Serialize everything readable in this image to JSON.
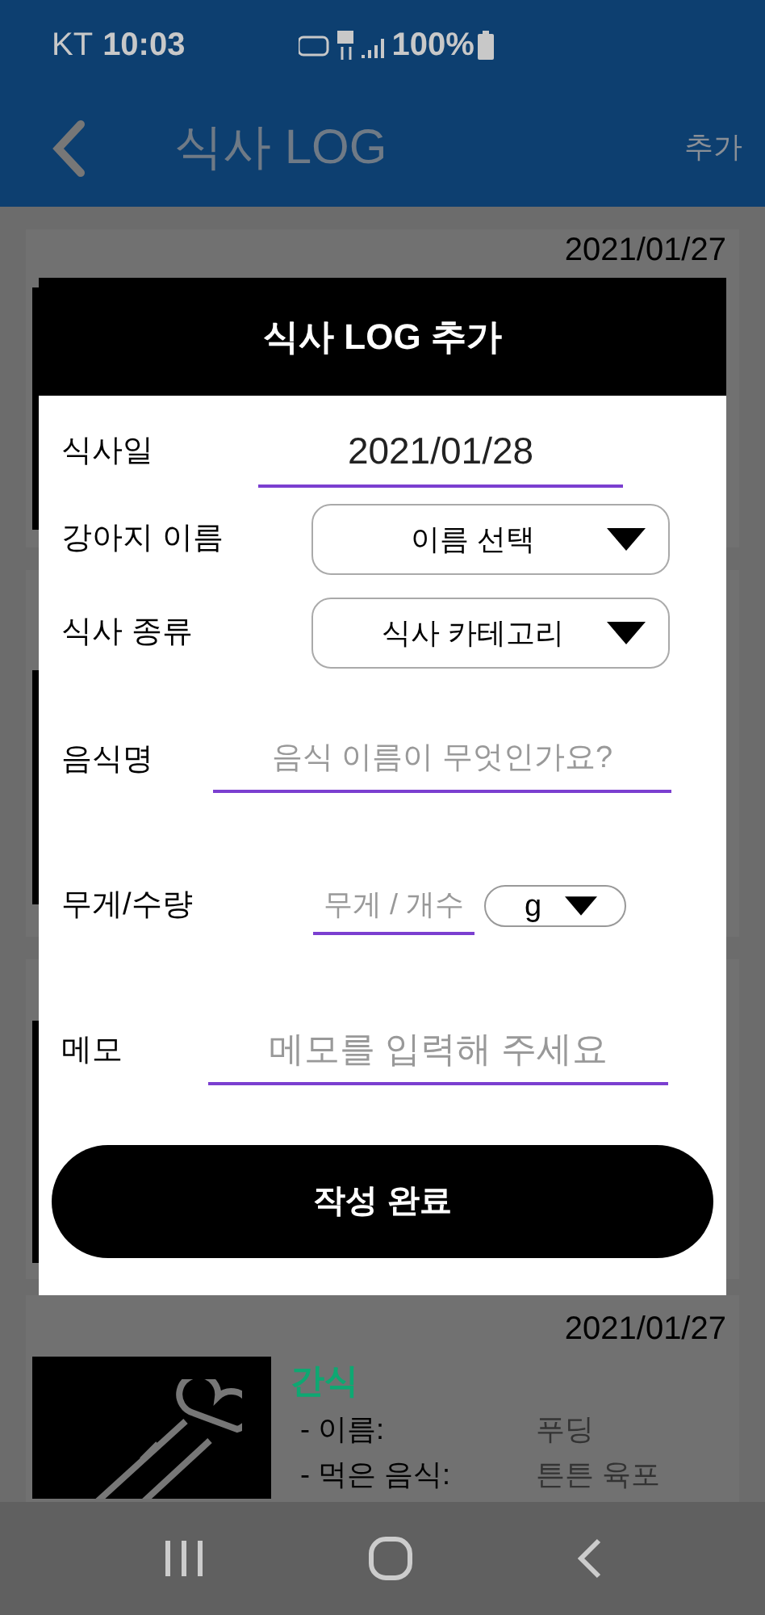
{
  "status_bar": {
    "carrier": "KT",
    "time": "10:03",
    "battery": "100%"
  },
  "app_bar": {
    "title": "식사 LOG",
    "action": "추가"
  },
  "top_card": {
    "date": "2021/01/27"
  },
  "bottom_card": {
    "date": "2021/01/27",
    "category": "간식",
    "rows": [
      {
        "label": "- 이름:",
        "value": "푸딩"
      },
      {
        "label": "- 먹은 음식:",
        "value": "튼튼 육포"
      }
    ]
  },
  "dialog": {
    "title": "식사 LOG 추가",
    "fields": [
      {
        "kind": "date",
        "label": "식사일",
        "value": "2021/01/28"
      },
      {
        "kind": "select",
        "label": "강아지 이름",
        "value": "이름 선택"
      },
      {
        "kind": "select",
        "label": "식사 종류",
        "value": "식사 카테고리"
      },
      {
        "kind": "text",
        "label": "음식명",
        "placeholder": "음식 이름이 무엇인가요?"
      },
      {
        "kind": "quantity",
        "label": "무게/수량",
        "placeholder": "무게 / 개수",
        "unit": "g"
      },
      {
        "kind": "memo",
        "label": "메모",
        "placeholder": "메모를 입력해 주세요"
      }
    ],
    "submit": "작성 완료"
  }
}
